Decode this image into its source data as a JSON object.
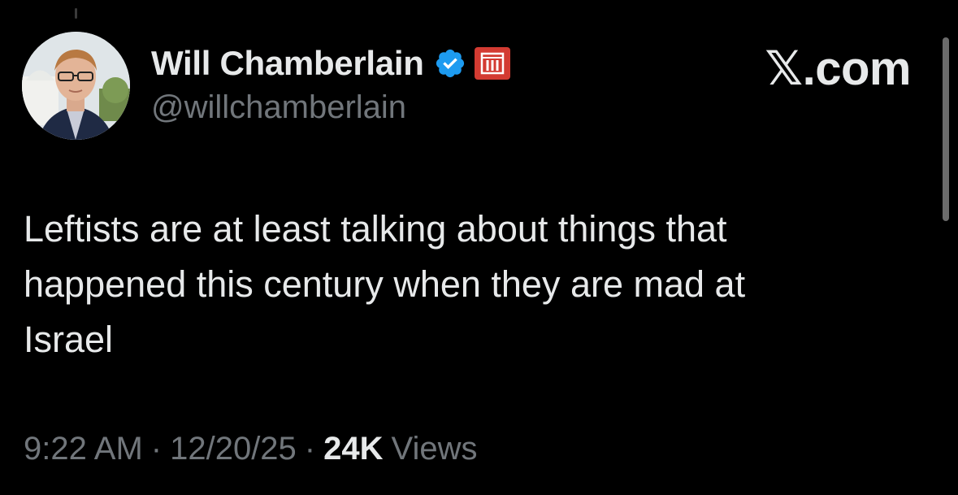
{
  "tweet": {
    "author": {
      "display_name": "Will Chamberlain",
      "handle": "@willchamberlain",
      "verified_icon": "verified-badge-icon",
      "affiliate_icon": "affiliate-badge-icon"
    },
    "brand": "𝕏.com",
    "text": "Leftists are at least talking about things that\nhappened this century when they are mad at\nIsrael",
    "time": "9:22 AM",
    "separator": "·",
    "date": "12/20/25",
    "views_count": "24K",
    "views_label": "Views"
  },
  "colors": {
    "background": "#000000",
    "primary_text": "#e7e9ea",
    "secondary_text": "#71767b",
    "verified_blue": "#1d9bf0",
    "affiliate_red": "#d33b32"
  }
}
